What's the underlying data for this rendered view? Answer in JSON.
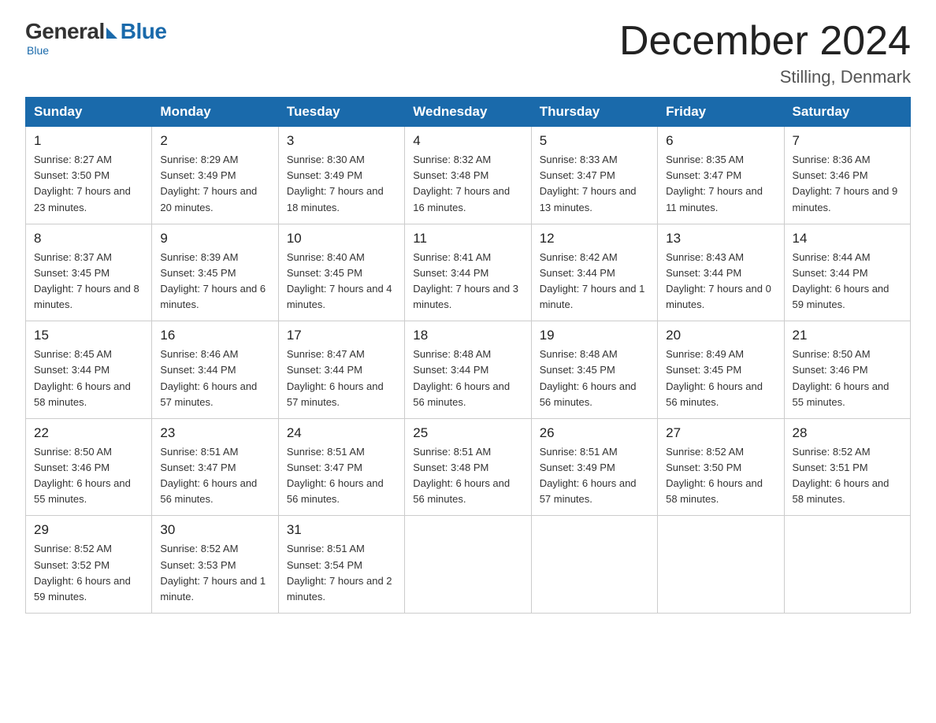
{
  "logo": {
    "general": "General",
    "blue": "Blue",
    "subtitle": "Blue"
  },
  "header": {
    "month_title": "December 2024",
    "location": "Stilling, Denmark"
  },
  "days_of_week": [
    "Sunday",
    "Monday",
    "Tuesday",
    "Wednesday",
    "Thursday",
    "Friday",
    "Saturday"
  ],
  "weeks": [
    [
      {
        "day": "1",
        "sunrise": "8:27 AM",
        "sunset": "3:50 PM",
        "daylight": "7 hours and 23 minutes."
      },
      {
        "day": "2",
        "sunrise": "8:29 AM",
        "sunset": "3:49 PM",
        "daylight": "7 hours and 20 minutes."
      },
      {
        "day": "3",
        "sunrise": "8:30 AM",
        "sunset": "3:49 PM",
        "daylight": "7 hours and 18 minutes."
      },
      {
        "day": "4",
        "sunrise": "8:32 AM",
        "sunset": "3:48 PM",
        "daylight": "7 hours and 16 minutes."
      },
      {
        "day": "5",
        "sunrise": "8:33 AM",
        "sunset": "3:47 PM",
        "daylight": "7 hours and 13 minutes."
      },
      {
        "day": "6",
        "sunrise": "8:35 AM",
        "sunset": "3:47 PM",
        "daylight": "7 hours and 11 minutes."
      },
      {
        "day": "7",
        "sunrise": "8:36 AM",
        "sunset": "3:46 PM",
        "daylight": "7 hours and 9 minutes."
      }
    ],
    [
      {
        "day": "8",
        "sunrise": "8:37 AM",
        "sunset": "3:45 PM",
        "daylight": "7 hours and 8 minutes."
      },
      {
        "day": "9",
        "sunrise": "8:39 AM",
        "sunset": "3:45 PM",
        "daylight": "7 hours and 6 minutes."
      },
      {
        "day": "10",
        "sunrise": "8:40 AM",
        "sunset": "3:45 PM",
        "daylight": "7 hours and 4 minutes."
      },
      {
        "day": "11",
        "sunrise": "8:41 AM",
        "sunset": "3:44 PM",
        "daylight": "7 hours and 3 minutes."
      },
      {
        "day": "12",
        "sunrise": "8:42 AM",
        "sunset": "3:44 PM",
        "daylight": "7 hours and 1 minute."
      },
      {
        "day": "13",
        "sunrise": "8:43 AM",
        "sunset": "3:44 PM",
        "daylight": "7 hours and 0 minutes."
      },
      {
        "day": "14",
        "sunrise": "8:44 AM",
        "sunset": "3:44 PM",
        "daylight": "6 hours and 59 minutes."
      }
    ],
    [
      {
        "day": "15",
        "sunrise": "8:45 AM",
        "sunset": "3:44 PM",
        "daylight": "6 hours and 58 minutes."
      },
      {
        "day": "16",
        "sunrise": "8:46 AM",
        "sunset": "3:44 PM",
        "daylight": "6 hours and 57 minutes."
      },
      {
        "day": "17",
        "sunrise": "8:47 AM",
        "sunset": "3:44 PM",
        "daylight": "6 hours and 57 minutes."
      },
      {
        "day": "18",
        "sunrise": "8:48 AM",
        "sunset": "3:44 PM",
        "daylight": "6 hours and 56 minutes."
      },
      {
        "day": "19",
        "sunrise": "8:48 AM",
        "sunset": "3:45 PM",
        "daylight": "6 hours and 56 minutes."
      },
      {
        "day": "20",
        "sunrise": "8:49 AM",
        "sunset": "3:45 PM",
        "daylight": "6 hours and 56 minutes."
      },
      {
        "day": "21",
        "sunrise": "8:50 AM",
        "sunset": "3:46 PM",
        "daylight": "6 hours and 55 minutes."
      }
    ],
    [
      {
        "day": "22",
        "sunrise": "8:50 AM",
        "sunset": "3:46 PM",
        "daylight": "6 hours and 55 minutes."
      },
      {
        "day": "23",
        "sunrise": "8:51 AM",
        "sunset": "3:47 PM",
        "daylight": "6 hours and 56 minutes."
      },
      {
        "day": "24",
        "sunrise": "8:51 AM",
        "sunset": "3:47 PM",
        "daylight": "6 hours and 56 minutes."
      },
      {
        "day": "25",
        "sunrise": "8:51 AM",
        "sunset": "3:48 PM",
        "daylight": "6 hours and 56 minutes."
      },
      {
        "day": "26",
        "sunrise": "8:51 AM",
        "sunset": "3:49 PM",
        "daylight": "6 hours and 57 minutes."
      },
      {
        "day": "27",
        "sunrise": "8:52 AM",
        "sunset": "3:50 PM",
        "daylight": "6 hours and 58 minutes."
      },
      {
        "day": "28",
        "sunrise": "8:52 AM",
        "sunset": "3:51 PM",
        "daylight": "6 hours and 58 minutes."
      }
    ],
    [
      {
        "day": "29",
        "sunrise": "8:52 AM",
        "sunset": "3:52 PM",
        "daylight": "6 hours and 59 minutes."
      },
      {
        "day": "30",
        "sunrise": "8:52 AM",
        "sunset": "3:53 PM",
        "daylight": "7 hours and 1 minute."
      },
      {
        "day": "31",
        "sunrise": "8:51 AM",
        "sunset": "3:54 PM",
        "daylight": "7 hours and 2 minutes."
      },
      null,
      null,
      null,
      null
    ]
  ],
  "labels": {
    "sunrise": "Sunrise:",
    "sunset": "Sunset:",
    "daylight": "Daylight:"
  }
}
